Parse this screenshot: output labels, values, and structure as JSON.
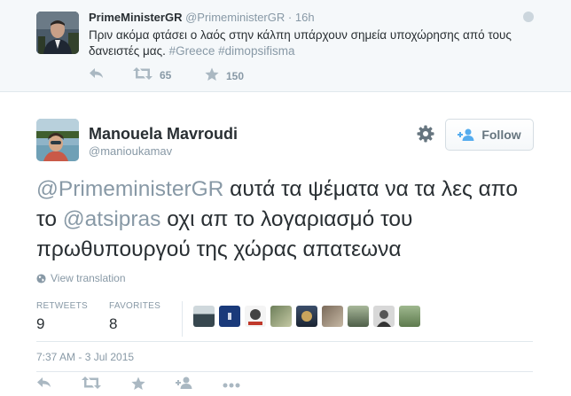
{
  "parent_tweet": {
    "name": "PrimeMinisterGR",
    "handle": "@PrimeministerGR",
    "separator": "·",
    "time": "16h",
    "text": "Πριν ακόμα φτάσει ο λαός στην κάλπη υπάρχουν σημεία υποχώρησης από τους δανειστές μας.",
    "hashtags": "#Greece #dimopsifisma",
    "retweets": "65",
    "favorites": "150",
    "icons": [
      "reply-icon",
      "retweet-icon",
      "star-icon",
      "more-icon"
    ]
  },
  "main_tweet": {
    "name": "Manouela Mavroudi",
    "handle": "@manioukamav",
    "follow_label": "Follow",
    "text_parts": {
      "mention1": "@PrimeministerGR",
      "text1": " αυτά τα ψέματα να τα λες απο το ",
      "mention2": "@atsipras",
      "text2": " οχι απ το λογαριασμό του πρωθυπουργού της χώρας απατεωνα"
    },
    "view_translation": "View translation",
    "retweets_label": "RETWEETS",
    "retweets": "9",
    "favorites_label": "FAVORITES",
    "favorites": "8",
    "favoriter_count": 9,
    "timestamp": "7:37 AM - 3 Jul 2015",
    "icons": [
      "reply-icon",
      "retweet-icon",
      "star-icon",
      "follow-icon",
      "more-icon"
    ]
  },
  "colors": {
    "text": "#292f33",
    "muted": "#8899a6",
    "icon": "#aab8c2",
    "parent_bg": "#f5f8fa",
    "border": "#e1e8ed"
  }
}
